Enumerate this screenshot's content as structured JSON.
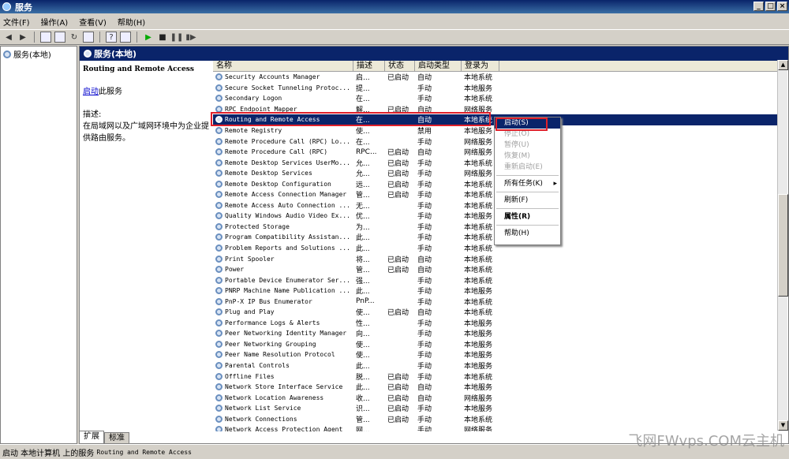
{
  "window": {
    "title": "服务"
  },
  "menu": [
    "文件(F)",
    "操作(A)",
    "查看(V)",
    "帮助(H)"
  ],
  "tree": {
    "item": "服务(本地)"
  },
  "main": {
    "header": "服务(本地)",
    "selected_name": "Routing and Remote Access",
    "start_link": "启动",
    "start_suffix": "此服务",
    "desc_label": "描述:",
    "desc_text": "在局域网以及广域网环境中为企业提供路由服务。"
  },
  "columns": [
    "名称",
    "描述",
    "状态",
    "启动类型",
    "登录为"
  ],
  "services": [
    {
      "name": "Security Accounts Manager",
      "desc": "启...",
      "status": "已启动",
      "type": "自动",
      "logon": "本地系统"
    },
    {
      "name": "Secure Socket Tunneling Protoc...",
      "desc": "提...",
      "status": "",
      "type": "手动",
      "logon": "本地服务"
    },
    {
      "name": "Secondary Logon",
      "desc": "在...",
      "status": "",
      "type": "手动",
      "logon": "本地系统"
    },
    {
      "name": "RPC Endpoint Mapper",
      "desc": "解...",
      "status": "已启动",
      "type": "自动",
      "logon": "网络服务"
    },
    {
      "name": "Routing and Remote Access",
      "desc": "在...",
      "status": "",
      "type": "自动",
      "logon": "本地系统"
    },
    {
      "name": "Remote Registry",
      "desc": "使...",
      "status": "",
      "type": "禁用",
      "logon": "本地服务"
    },
    {
      "name": "Remote Procedure Call (RPC) Lo...",
      "desc": "在...",
      "status": "",
      "type": "手动",
      "logon": "网络服务"
    },
    {
      "name": "Remote Procedure Call (RPC)",
      "desc": "RPC...",
      "status": "已启动",
      "type": "自动",
      "logon": "网络服务"
    },
    {
      "name": "Remote Desktop Services UserMo...",
      "desc": "允...",
      "status": "已启动",
      "type": "手动",
      "logon": "本地系统"
    },
    {
      "name": "Remote Desktop Services",
      "desc": "允...",
      "status": "已启动",
      "type": "手动",
      "logon": "网络服务"
    },
    {
      "name": "Remote Desktop Configuration",
      "desc": "远...",
      "status": "已启动",
      "type": "手动",
      "logon": "本地系统"
    },
    {
      "name": "Remote Access Connection Manager",
      "desc": "管...",
      "status": "已启动",
      "type": "手动",
      "logon": "本地系统"
    },
    {
      "name": "Remote Access Auto Connection ...",
      "desc": "无...",
      "status": "",
      "type": "手动",
      "logon": "本地系统"
    },
    {
      "name": "Quality Windows Audio Video Ex...",
      "desc": "优...",
      "status": "",
      "type": "手动",
      "logon": "本地服务"
    },
    {
      "name": "Protected Storage",
      "desc": "为...",
      "status": "",
      "type": "手动",
      "logon": "本地系统"
    },
    {
      "name": "Program Compatibility Assistan...",
      "desc": "此...",
      "status": "",
      "type": "手动",
      "logon": "本地系统"
    },
    {
      "name": "Problem Reports and Solutions ...",
      "desc": "此...",
      "status": "",
      "type": "手动",
      "logon": "本地系统"
    },
    {
      "name": "Print Spooler",
      "desc": "将...",
      "status": "已启动",
      "type": "自动",
      "logon": "本地系统"
    },
    {
      "name": "Power",
      "desc": "管...",
      "status": "已启动",
      "type": "自动",
      "logon": "本地系统"
    },
    {
      "name": "Portable Device Enumerator Ser...",
      "desc": "强...",
      "status": "",
      "type": "手动",
      "logon": "本地系统"
    },
    {
      "name": "PNRP Machine Name Publication ...",
      "desc": "此...",
      "status": "",
      "type": "手动",
      "logon": "本地服务"
    },
    {
      "name": "PnP-X IP Bus Enumerator",
      "desc": "PnP...",
      "status": "",
      "type": "手动",
      "logon": "本地系统"
    },
    {
      "name": "Plug and Play",
      "desc": "使...",
      "status": "已启动",
      "type": "自动",
      "logon": "本地系统"
    },
    {
      "name": "Performance Logs & Alerts",
      "desc": "性...",
      "status": "",
      "type": "手动",
      "logon": "本地服务"
    },
    {
      "name": "Peer Networking Identity Manager",
      "desc": "向...",
      "status": "",
      "type": "手动",
      "logon": "本地服务"
    },
    {
      "name": "Peer Networking Grouping",
      "desc": "使...",
      "status": "",
      "type": "手动",
      "logon": "本地服务"
    },
    {
      "name": "Peer Name Resolution Protocol",
      "desc": "使...",
      "status": "",
      "type": "手动",
      "logon": "本地服务"
    },
    {
      "name": "Parental Controls",
      "desc": "此...",
      "status": "",
      "type": "手动",
      "logon": "本地服务"
    },
    {
      "name": "Offline Files",
      "desc": "脱...",
      "status": "已启动",
      "type": "手动",
      "logon": "本地系统"
    },
    {
      "name": "Network Store Interface Service",
      "desc": "此...",
      "status": "已启动",
      "type": "自动",
      "logon": "本地服务"
    },
    {
      "name": "Network Location Awareness",
      "desc": "收...",
      "status": "已启动",
      "type": "自动",
      "logon": "网络服务"
    },
    {
      "name": "Network List Service",
      "desc": "识...",
      "status": "已启动",
      "type": "手动",
      "logon": "本地服务"
    },
    {
      "name": "Network Connections",
      "desc": "管...",
      "status": "已启动",
      "type": "手动",
      "logon": "本地系统"
    },
    {
      "name": "Network Access Protection Agent",
      "desc": "网...",
      "status": "",
      "type": "手动",
      "logon": "网络服务"
    }
  ],
  "context_menu": [
    {
      "label": "启动(S)",
      "state": "highlight"
    },
    {
      "label": "停止(O)",
      "state": "disabled"
    },
    {
      "label": "暂停(U)",
      "state": "disabled"
    },
    {
      "label": "恢复(M)",
      "state": "disabled"
    },
    {
      "label": "重新启动(E)",
      "state": "disabled"
    },
    {
      "sep": true
    },
    {
      "label": "所有任务(K)",
      "state": "normal",
      "submenu": true
    },
    {
      "sep": true
    },
    {
      "label": "刷新(F)",
      "state": "normal"
    },
    {
      "sep": true
    },
    {
      "label": "属性(R)",
      "state": "bold"
    },
    {
      "sep": true
    },
    {
      "label": "帮助(H)",
      "state": "normal"
    }
  ],
  "tabs": [
    "扩展",
    "标准"
  ],
  "status": {
    "prefix": "启动 本地计算机 上的服务",
    "service": "Routing and Remote Access"
  },
  "watermark": "飞网FWvps.COM云主机"
}
